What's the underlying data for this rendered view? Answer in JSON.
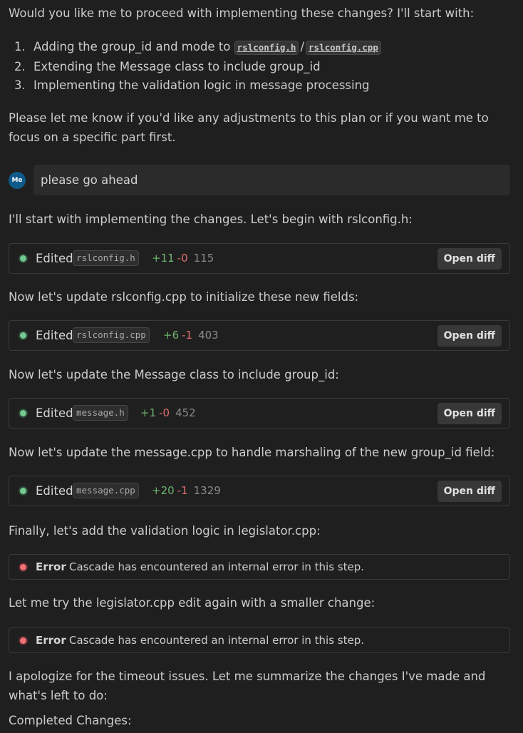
{
  "intro": "Would you like me to proceed with implementing these changes? I'll start with:",
  "plan": {
    "item1_num": "1.",
    "item1_prefix": "Adding the group_id and mode to",
    "item1_file_a": "rslconfig.h",
    "item1_sep": "/",
    "item1_file_b": "rslconfig.cpp",
    "item2_num": "2.",
    "item2": "Extending the Message class to include group_id",
    "item3_num": "3.",
    "item3": "Implementing the validation logic in message processing"
  },
  "followup": "Please let me know if you'd like any adjustments to this plan or if you want me to focus on a specific part first.",
  "user": {
    "avatar": "Me",
    "message": "please go ahead"
  },
  "assistant": {
    "p1": "I'll start with implementing the changes. Let's begin with rslconfig.h:",
    "p2": "Now let's update rslconfig.cpp to initialize these new fields:",
    "p3": "Now let's update the Message class to include group_id:",
    "p4": "Now let's update the message.cpp to handle marshaling of the new group_id field:",
    "p5": "Finally, let's add the validation logic in legislator.cpp:",
    "p6": "Let me try the legislator.cpp edit again with a smaller change:",
    "p7": "I apologize for the timeout issues. Let me summarize the changes I've made and what's left to do:",
    "p8": "Completed Changes:"
  },
  "edits": [
    {
      "label": "Edited",
      "file": "rslconfig.h",
      "added": "+11",
      "removed": "-0",
      "lines": "115",
      "button": "Open diff"
    },
    {
      "label": "Edited",
      "file": "rslconfig.cpp",
      "added": "+6",
      "removed": "-1",
      "lines": "403",
      "button": "Open diff"
    },
    {
      "label": "Edited",
      "file": "message.h",
      "added": "+1",
      "removed": "-0",
      "lines": "452",
      "button": "Open diff"
    },
    {
      "label": "Edited",
      "file": "message.cpp",
      "added": "+20",
      "removed": "-1",
      "lines": "1329",
      "button": "Open diff"
    }
  ],
  "errors": [
    {
      "title": "Error",
      "message": "Cascade has encountered an internal error in this step."
    },
    {
      "title": "Error",
      "message": "Cascade has encountered an internal error in this step."
    }
  ],
  "colors": {
    "background": "#1f1f1f",
    "added": "#6fb46f",
    "removed": "#e06c6c",
    "success_dot": "#73c991",
    "error_dot": "#f07078",
    "avatar": "#0e5a8a"
  }
}
